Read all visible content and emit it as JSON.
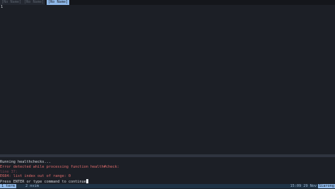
{
  "tabs": [
    {
      "label": "[No Name]",
      "active": false
    },
    {
      "label": "[No Name]",
      "active": false
    },
    {
      "label": "[No Name]",
      "active": true
    }
  ],
  "editor": {
    "line_number": "1"
  },
  "messages": [
    {
      "text": "Running healthchecks...",
      "kind": "normal"
    },
    {
      "text": "Error detected while processing function health#check:",
      "kind": "error"
    },
    {
      "text": "line   37:",
      "kind": "dim"
    },
    {
      "text": "E684: list index out of range: 0",
      "kind": "error"
    },
    {
      "text": "Press ENTER or type command to continue",
      "kind": "normal"
    }
  ],
  "statusbar": {
    "window_active": "1 term",
    "window_inactive": "2 nvim",
    "clock": "15:09 29 Nov",
    "host": "Siarong"
  },
  "colors": {
    "background": "#1c1f26",
    "accent": "#8fb8e8",
    "error": "#e06c6c"
  }
}
